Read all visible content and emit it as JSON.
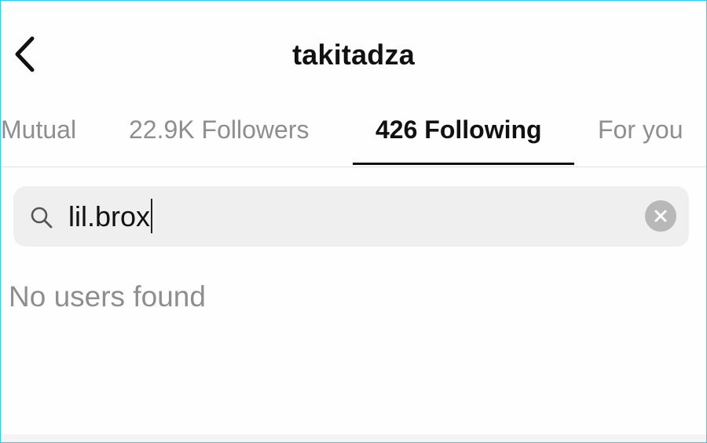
{
  "header": {
    "back_icon": "chevron-left-icon",
    "title": "takitadza"
  },
  "tabs": [
    {
      "label": "Mutual",
      "active": false
    },
    {
      "label": "22.9K Followers",
      "active": false
    },
    {
      "label": "426 Following",
      "active": true
    },
    {
      "label": "For you",
      "active": false
    }
  ],
  "search": {
    "icon": "search-icon",
    "value": "lil.brox",
    "clear_icon": "clear-icon"
  },
  "results": {
    "empty_message": "No users found"
  },
  "colors": {
    "frame_border": "#35c8f0",
    "active_text": "#111111",
    "inactive_text": "#8e8e8e",
    "search_bg": "#efefef",
    "clear_button_bg": "#b8b8b8"
  }
}
